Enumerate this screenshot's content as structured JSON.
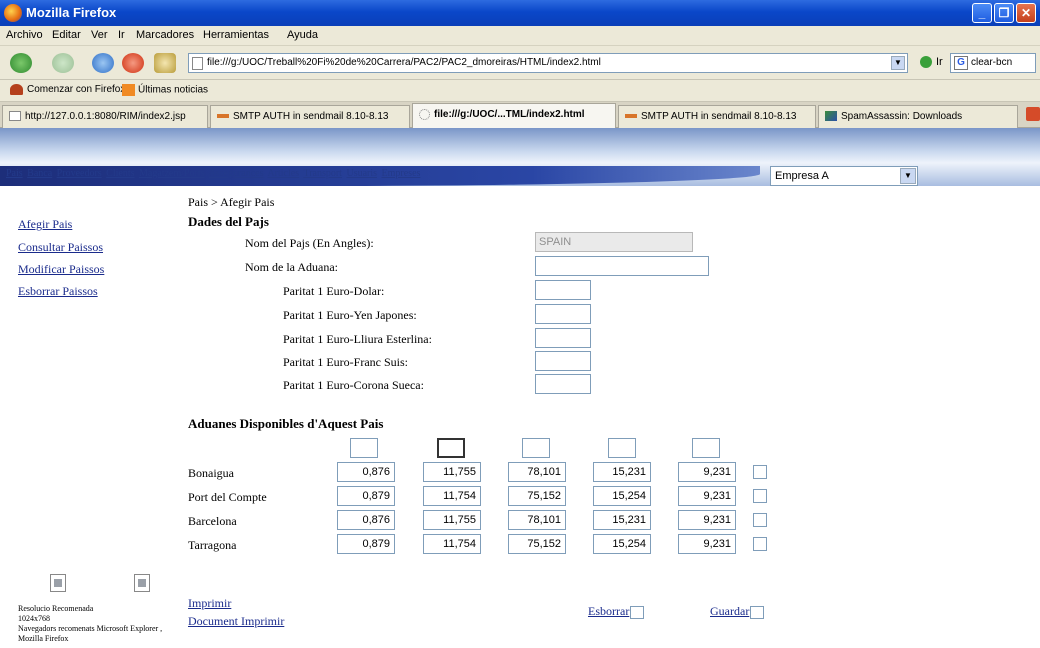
{
  "window": {
    "title": "Mozilla Firefox"
  },
  "menu": [
    "Archivo",
    "Editar",
    "Ver",
    "Ir",
    "Marcadores",
    "Herramientas",
    "Ayuda"
  ],
  "nav": {
    "url": "file:///g:/UOC/Treball%20Fi%20de%20Carrera/PAC2/PAC2_dmoreiras/HTML/index2.html",
    "go_label": "Ir",
    "search_value": "clear-bcn"
  },
  "bookmarks": [
    "Comenzar con Firefox",
    "Últimas noticias"
  ],
  "tabs": [
    "http://127.0.0.1:8080/RIM/index2.jsp",
    "SMTP AUTH in sendmail 8.10-8.13",
    "file:///g:/UOC/...TML/index2.html",
    "SMTP AUTH in sendmail 8.10-8.13",
    "SpamAssassin: Downloads"
  ],
  "page": {
    "nav_links": [
      "Pais",
      "Banca",
      "Proveedors",
      "Clients",
      "Magatzem/Ports",
      "Assegurances",
      "Articles",
      "Transport",
      "Usuaris",
      "Empreses"
    ],
    "company_select": "Empresa A",
    "side_links": [
      "Afegir Pais",
      "Consultar Paissos",
      "Modificar Paissos",
      "Esborrar Paissos"
    ],
    "breadcrumb": "Pais > Afegir Pais",
    "section_title": "Dades del Pajs",
    "fields": [
      {
        "label": "Nom del Pajs (En Angles):",
        "value": "SPAIN"
      },
      {
        "label": "Nom de la Aduana:",
        "value": ""
      },
      {
        "label": "Paritat 1 Euro-Dolar:",
        "value": ""
      },
      {
        "label": "Paritat 1 Euro-Yen Japones:",
        "value": ""
      },
      {
        "label": "Paritat 1 Euro-Lliura Esterlina:",
        "value": ""
      },
      {
        "label": "Paritat 1 Euro-Franc Suis:",
        "value": ""
      },
      {
        "label": "Paritat 1 Euro-Corona Sueca:",
        "value": ""
      }
    ],
    "customs_title": "Aduanes Disponibles d'Aquest Pais",
    "customs_rows": [
      {
        "name": "Bonaigua",
        "values": [
          "0,876",
          "11,755",
          "78,101",
          "15,231",
          "9,231"
        ]
      },
      {
        "name": "Port del Compte",
        "values": [
          "0,879",
          "11,754",
          "75,152",
          "15,254",
          "9,231"
        ]
      },
      {
        "name": "Barcelona",
        "values": [
          "0,876",
          "11,755",
          "78,101",
          "15,231",
          "9,231"
        ]
      },
      {
        "name": "Tarragona",
        "values": [
          "0,879",
          "11,754",
          "75,152",
          "15,254",
          "9,231"
        ]
      }
    ],
    "footer_note": [
      "Resolucio Recomenada",
      "1024x768",
      "Navegadors recomenats Microsoft Explorer ,",
      "Mozilla Firefox"
    ],
    "print_link": "Imprimir",
    "print_doc_link": "Document Imprimir",
    "delete_label": "Esborrar",
    "save_label": "Guardar"
  },
  "colors": {
    "titlebar": "#0a47c9",
    "link": "#1a2b8c",
    "chrome": "#ece9d8"
  }
}
